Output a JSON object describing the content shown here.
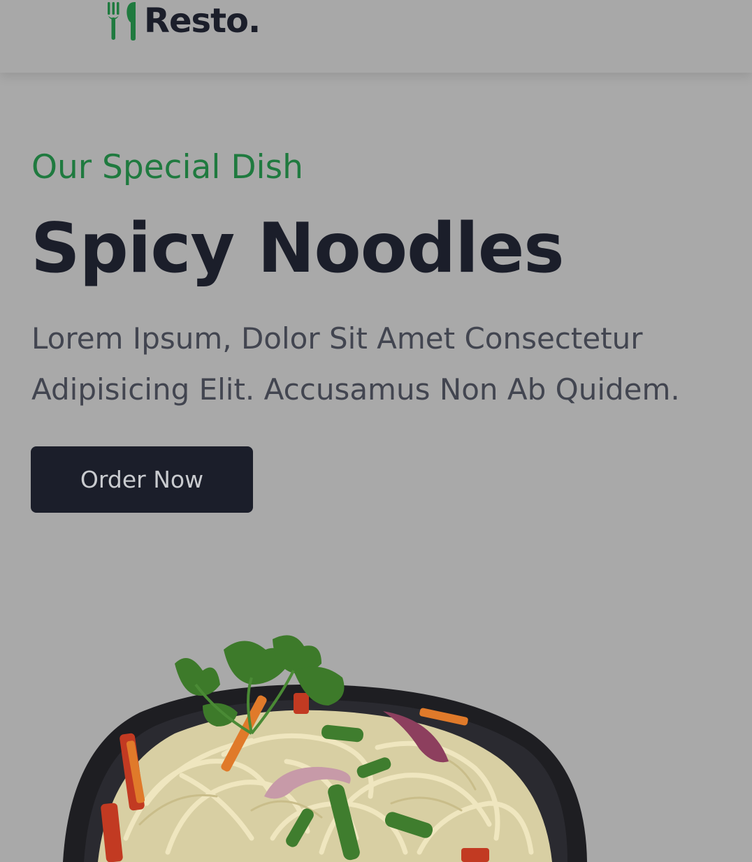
{
  "header": {
    "logo_text": "Resto.",
    "logo_icon": "fork-spoon-icon"
  },
  "hero": {
    "subtitle": "Our Special Dish",
    "title": "Spicy Noodles",
    "description": "Lorem Ipsum, Dolor Sit Amet Consectetur Adipisicing Elit. Accusamus Non Ab Quidem.",
    "order_button_label": "Order Now"
  },
  "colors": {
    "accent_green": "#1f7a3f",
    "dark": "#1b1e2a",
    "background": "#a9a9a9"
  }
}
